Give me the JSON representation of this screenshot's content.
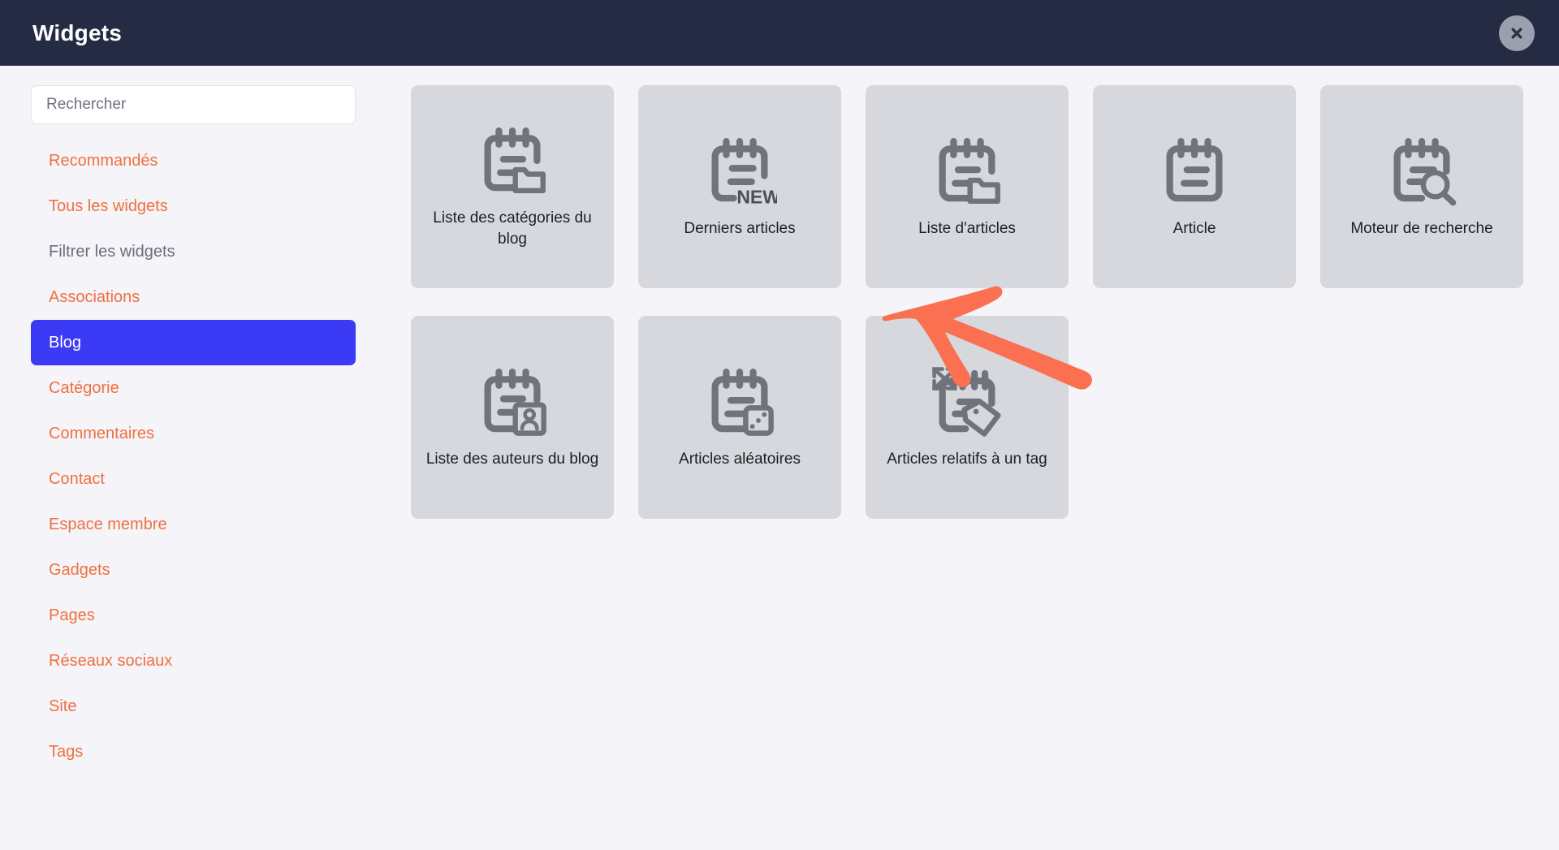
{
  "header": {
    "title": "Widgets",
    "close_label": "×",
    "close_icon": "close-icon"
  },
  "sidebar": {
    "search": {
      "placeholder": "Rechercher",
      "value": "",
      "icon": "search-icon"
    },
    "items": [
      {
        "label": "Recommandés",
        "state": "link"
      },
      {
        "label": "Tous les widgets",
        "state": "link"
      },
      {
        "label": "Filtrer les widgets",
        "state": "muted"
      },
      {
        "label": "Associations",
        "state": "link"
      },
      {
        "label": "Blog",
        "state": "active"
      },
      {
        "label": "Catégorie",
        "state": "link"
      },
      {
        "label": "Commentaires",
        "state": "link"
      },
      {
        "label": "Contact",
        "state": "link"
      },
      {
        "label": "Espace membre",
        "state": "link"
      },
      {
        "label": "Gadgets",
        "state": "link"
      },
      {
        "label": "Pages",
        "state": "link"
      },
      {
        "label": "Réseaux sociaux",
        "state": "link"
      },
      {
        "label": "Site",
        "state": "link"
      },
      {
        "label": "Tags",
        "state": "link"
      }
    ]
  },
  "main": {
    "widgets": [
      {
        "label": "Liste des catégories du blog",
        "icon": "notepad-folder-icon"
      },
      {
        "label": "Derniers articles",
        "icon": "notepad-new-icon",
        "badge_text": "NEW"
      },
      {
        "label": "Liste d'articles",
        "icon": "notepad-folder-icon"
      },
      {
        "label": "Article",
        "icon": "notepad-icon"
      },
      {
        "label": "Moteur de recherche",
        "icon": "notepad-search-icon"
      },
      {
        "label": "Liste des auteurs du blog",
        "icon": "notepad-person-icon"
      },
      {
        "label": "Articles aléatoires",
        "icon": "notepad-dice-icon"
      },
      {
        "label": "Articles relatifs à un tag",
        "icon": "notepad-tag-icon"
      }
    ]
  },
  "annotation": {
    "arrow": "left-pointing-arrow",
    "target": "Articles relatifs à un tag"
  },
  "colors": {
    "header_bg": "#242b42",
    "page_bg": "#f4f4f9",
    "accent_link": "#f1703f",
    "accent_active": "#3b3bf5",
    "card_bg": "#d6d8dd",
    "icon_gray": "#6f737c",
    "annotation": "#fa7050"
  }
}
